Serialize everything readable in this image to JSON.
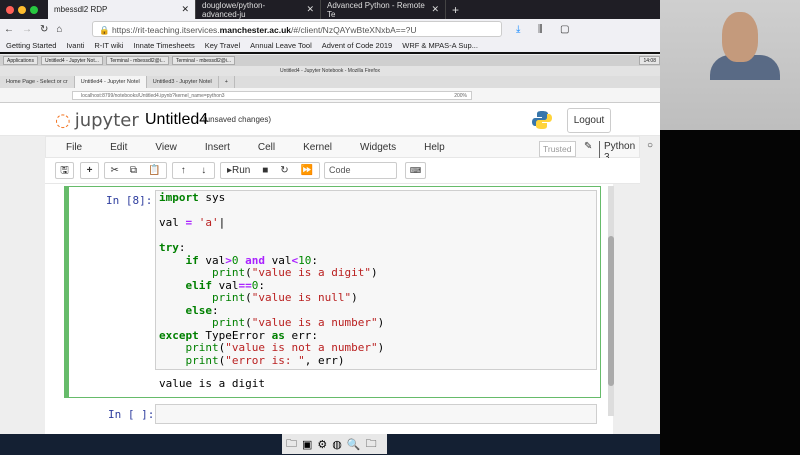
{
  "browser": {
    "tabs": [
      "mbessdl2 RDP",
      "douglowe/python-advanced-ju",
      "Advanced Python - Remote Te"
    ],
    "url_prefix": "https://rit-teaching.itservices.",
    "url_domain": "manchester.ac.uk",
    "url_suffix": "/#/client/NzQAYwBteXNxbA==?U",
    "bookmarks": [
      "Getting Started",
      "Ivanti",
      "R-IT wiki",
      "Innate Timesheets",
      "Key Travel",
      "Annual Leave Tool",
      "Advent of Code 2019",
      "WRF & MPAS-A Sup..."
    ]
  },
  "remote": {
    "taskbar": [
      "Applications",
      "Untitled4 - Jupyter Not...",
      "Terminal - mbessdl2@i...",
      "Terminal - mbessdl2@i..."
    ],
    "clock": "14:08",
    "window_title": "Untitled4 - Jupyter Notebook - Mozilla Firefox",
    "tabs": [
      "Home Page - Select or cr",
      "Untitled4 - Jupyter Notel",
      "Untitled3 - Jupyter Notel"
    ],
    "url": "localhost:8799/notebooks/Untitled4.ipynb?kernel_name=python3",
    "zoom": "200%"
  },
  "jupyter": {
    "logo": "jupyter",
    "name": "Untitled4",
    "status": "(unsaved changes)",
    "logout": "Logout",
    "menu": [
      "File",
      "Edit",
      "View",
      "Insert",
      "Cell",
      "Kernel",
      "Widgets",
      "Help"
    ],
    "trusted": "Trusted",
    "kernel": "Python 3",
    "toolbar": {
      "run": "Run",
      "cell_type": "Code"
    }
  },
  "cells": [
    {
      "prompt": "In [8]:",
      "output": "value is a digit"
    },
    {
      "prompt": "In [ ]:"
    }
  ]
}
